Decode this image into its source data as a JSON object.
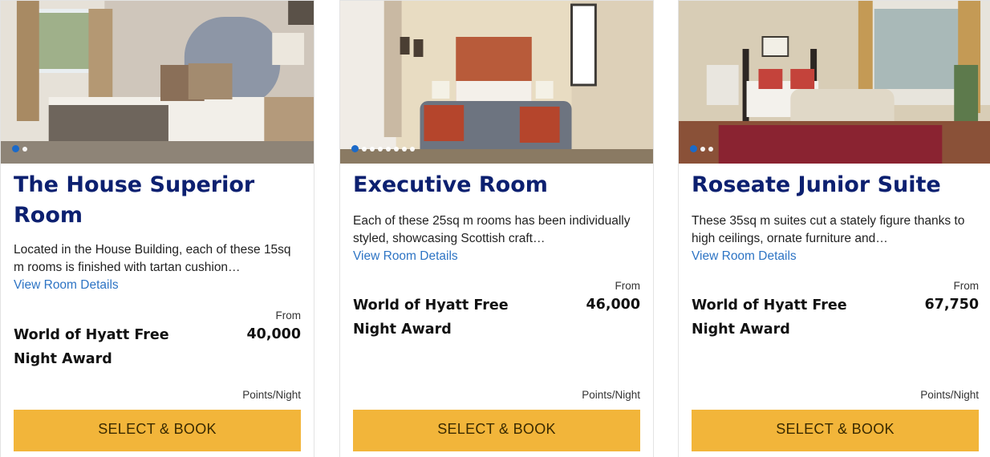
{
  "rooms": [
    {
      "title": "The House Superior Room",
      "description": "Located in the House Building, each of these 15sq m rooms is finished with tartan cushion…",
      "details_link": "View Room Details",
      "price_prefix": "From",
      "award_label": "World of Hyatt Free Night Award",
      "points": "40,000",
      "points_unit": "Points/Night",
      "book_label": "SELECT & BOOK",
      "photo_count": 2,
      "active_photo": 1
    },
    {
      "title": "Executive Room",
      "description": "Each of these 25sq m rooms has been individually styled, showcasing Scottish craft…",
      "details_link": "View Room Details",
      "price_prefix": "From",
      "award_label": "World of Hyatt Free Night Award",
      "points": "46,000",
      "points_unit": "Points/Night",
      "book_label": "SELECT & BOOK",
      "photo_count": 8,
      "active_photo": 1
    },
    {
      "title": "Roseate Junior Suite",
      "description": "These 35sq m suites cut a stately figure thanks to high ceilings, ornate furniture and…",
      "details_link": "View Room Details",
      "price_prefix": "From",
      "award_label": "World of Hyatt Free Night Award",
      "points": "67,750",
      "points_unit": "Points/Night",
      "book_label": "SELECT & BOOK",
      "photo_count": 3,
      "active_photo": 1
    }
  ],
  "colors": {
    "title": "#0c2070",
    "link": "#2d74c4",
    "button": "#f2b53a",
    "dot_active": "#1b6ac9"
  }
}
